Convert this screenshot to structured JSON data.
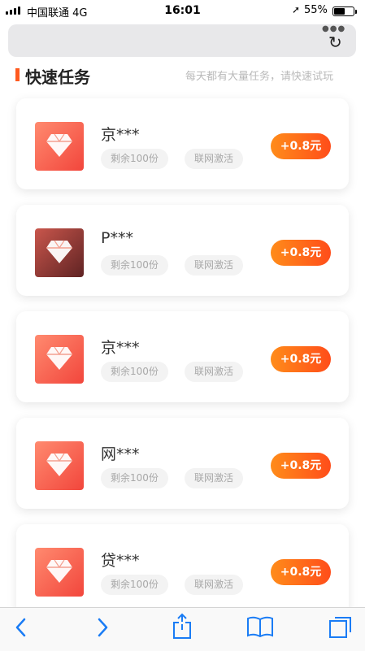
{
  "status": {
    "carrier": "中国联通  4G",
    "time": "16:01",
    "battery": "55%",
    "battery_level": 0.55
  },
  "section": {
    "title": "快速任务",
    "subtitle": "每天都有大量任务，请快速试玩"
  },
  "tasks": [
    {
      "name": "京***",
      "remaining": "剩余100份",
      "mode": "联网激活",
      "reward": "+0.8元"
    },
    {
      "name": "P***",
      "remaining": "剩余100份",
      "mode": "联网激活",
      "reward": "+0.8元"
    },
    {
      "name": "京***",
      "remaining": "剩余100份",
      "mode": "联网激活",
      "reward": "+0.8元"
    },
    {
      "name": "网***",
      "remaining": "剩余100份",
      "mode": "联网激活",
      "reward": "+0.8元"
    },
    {
      "name": "贷***",
      "remaining": "剩余100份",
      "mode": "联网激活",
      "reward": "+0.8元"
    }
  ],
  "icons": {
    "reload": "reload-icon",
    "back": "back-icon",
    "forward": "forward-icon",
    "share": "share-icon",
    "bookmarks": "bookmarks-icon",
    "tabs": "tabs-icon",
    "task_thumb": "diamond-icon"
  },
  "colors": {
    "accent": "#ff5a1f",
    "reward_from": "#ff8c1a",
    "reward_to": "#ff4d1a",
    "toolbar_icon": "#1a7cf5"
  }
}
